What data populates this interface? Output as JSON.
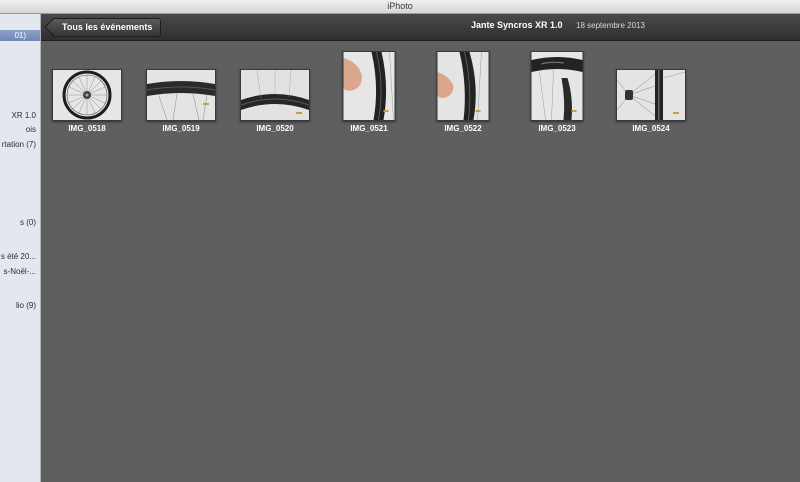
{
  "window": {
    "title": "iPhoto"
  },
  "sidebar": {
    "items": [
      {
        "label": "01)",
        "selected": true
      },
      {
        "label": "XR 1.0"
      },
      {
        "label": "ois"
      },
      {
        "label": "rtation (7)"
      },
      {
        "label": "s (0)"
      },
      {
        "label": "s été 20..."
      },
      {
        "label": "s-Noël-..."
      },
      {
        "label": "lio (9)"
      }
    ]
  },
  "toolbar": {
    "back_label": "Tous les événements",
    "event_title": "Jante Syncros XR 1.0",
    "event_date": "18 septembre 2013"
  },
  "photos": [
    {
      "name": "IMG_0518",
      "orientation": "landscape",
      "subject": "wheel-hub-icon"
    },
    {
      "name": "IMG_0519",
      "orientation": "landscape",
      "subject": "rim-top-icon"
    },
    {
      "name": "IMG_0520",
      "orientation": "landscape",
      "subject": "rim-curve-icon"
    },
    {
      "name": "IMG_0521",
      "orientation": "portrait",
      "subject": "rim-hand-icon"
    },
    {
      "name": "IMG_0522",
      "orientation": "portrait",
      "subject": "rim-hand-icon"
    },
    {
      "name": "IMG_0523",
      "orientation": "portrait",
      "subject": "rim-logo-icon"
    },
    {
      "name": "IMG_0524",
      "orientation": "landscape",
      "subject": "wheel-side-icon"
    }
  ],
  "colors": {
    "background": "#5f5f5f",
    "toolbar": "#3a3a3a",
    "sidebar": "#e4e8ee",
    "selection": "#7b91bd"
  }
}
